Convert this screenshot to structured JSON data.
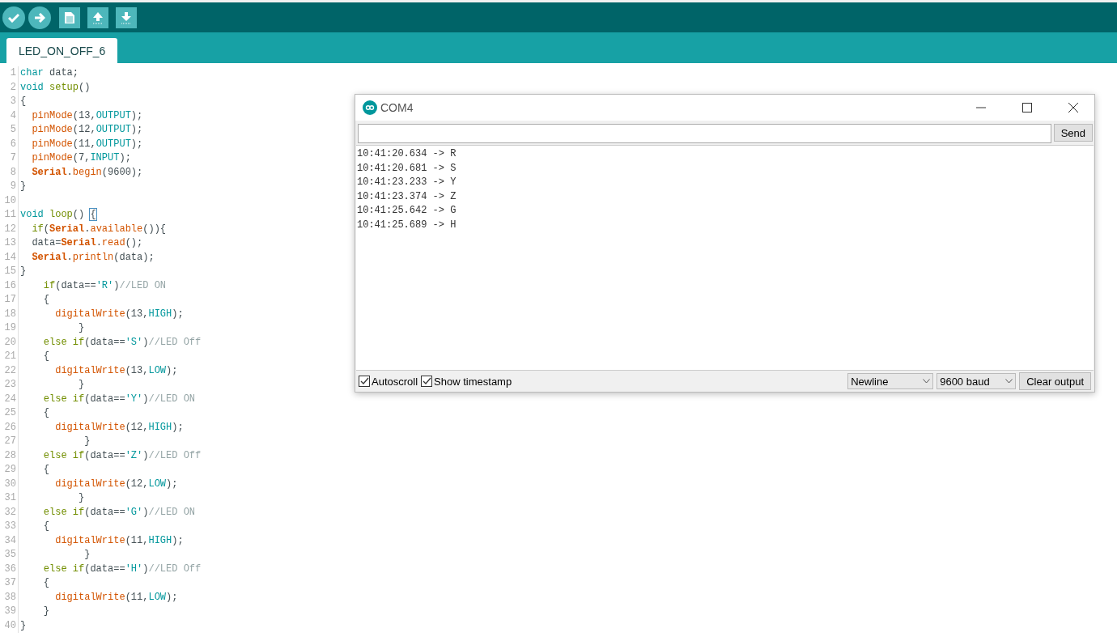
{
  "toolbar": {
    "buttons": [
      {
        "kind": "verify"
      },
      {
        "kind": "upload"
      },
      {
        "kind": "new"
      },
      {
        "kind": "open"
      },
      {
        "kind": "save"
      }
    ]
  },
  "tabs": [
    {
      "label": "LED_ON_OFF_6",
      "selected": true
    }
  ],
  "editor": {
    "lines": [
      {
        "number": "1",
        "tokens": [
          {
            "kind": "type",
            "text": "char"
          },
          {
            "kind": "plain",
            "text": " data;"
          }
        ]
      },
      {
        "number": "2",
        "tokens": [
          {
            "kind": "type",
            "text": "void "
          },
          {
            "kind": "control",
            "text": "setup"
          },
          {
            "kind": "plain",
            "text": "()"
          }
        ]
      },
      {
        "number": "3",
        "tokens": [
          {
            "kind": "plain",
            "text": "{"
          }
        ]
      },
      {
        "number": "4",
        "tokens": [
          {
            "kind": "function",
            "text": "  pinMode"
          },
          {
            "kind": "plain",
            "text": "(13,"
          },
          {
            "kind": "constant",
            "text": "OUTPUT"
          },
          {
            "kind": "plain",
            "text": ");"
          }
        ]
      },
      {
        "number": "5",
        "tokens": [
          {
            "kind": "function",
            "text": "  pinMode"
          },
          {
            "kind": "plain",
            "text": "(12,"
          },
          {
            "kind": "constant",
            "text": "OUTPUT"
          },
          {
            "kind": "plain",
            "text": ");"
          }
        ]
      },
      {
        "number": "6",
        "tokens": [
          {
            "kind": "function",
            "text": "  pinMode"
          },
          {
            "kind": "plain",
            "text": "(11,"
          },
          {
            "kind": "constant",
            "text": "OUTPUT"
          },
          {
            "kind": "plain",
            "text": ");"
          }
        ]
      },
      {
        "number": "7",
        "tokens": [
          {
            "kind": "function",
            "text": "  pinMode"
          },
          {
            "kind": "plain",
            "text": "(7,"
          },
          {
            "kind": "constant",
            "text": "INPUT"
          },
          {
            "kind": "plain",
            "text": ");"
          }
        ]
      },
      {
        "number": "8",
        "tokens": [
          {
            "kind": "object",
            "text": "  Serial"
          },
          {
            "kind": "plain",
            "text": "."
          },
          {
            "kind": "function",
            "text": "begin"
          },
          {
            "kind": "plain",
            "text": "(9600);"
          }
        ]
      },
      {
        "number": "9",
        "tokens": [
          {
            "kind": "plain",
            "text": "}"
          }
        ]
      },
      {
        "number": "10"
      },
      {
        "number": "11",
        "tokens": [
          {
            "kind": "type",
            "text": "void "
          },
          {
            "kind": "control",
            "text": "loop"
          },
          {
            "kind": "plain",
            "text": "() "
          },
          {
            "kind": "bracket_match",
            "text": "{"
          }
        ]
      },
      {
        "number": "12",
        "tokens": [
          {
            "kind": "control",
            "text": "  if"
          },
          {
            "kind": "plain",
            "text": "("
          },
          {
            "kind": "object",
            "text": "Serial"
          },
          {
            "kind": "plain",
            "text": "."
          },
          {
            "kind": "function",
            "text": "available"
          },
          {
            "kind": "plain",
            "text": "()){"
          }
        ]
      },
      {
        "number": "13",
        "tokens": [
          {
            "kind": "plain",
            "text": "  data="
          },
          {
            "kind": "object",
            "text": "Serial"
          },
          {
            "kind": "plain",
            "text": "."
          },
          {
            "kind": "function",
            "text": "read"
          },
          {
            "kind": "plain",
            "text": "();"
          }
        ]
      },
      {
        "number": "14",
        "tokens": [
          {
            "kind": "object",
            "text": "  Serial"
          },
          {
            "kind": "plain",
            "text": "."
          },
          {
            "kind": "function",
            "text": "println"
          },
          {
            "kind": "plain",
            "text": "(data);"
          }
        ]
      },
      {
        "number": "15",
        "tokens": [
          {
            "kind": "plain",
            "text": "}"
          }
        ]
      },
      {
        "number": "16",
        "tokens": [
          {
            "kind": "control",
            "text": "    if"
          },
          {
            "kind": "plain",
            "text": "(data=="
          },
          {
            "kind": "string",
            "text": "'R'"
          },
          {
            "kind": "plain",
            "text": ")"
          },
          {
            "kind": "comment",
            "text": "//LED ON"
          }
        ]
      },
      {
        "number": "17",
        "tokens": [
          {
            "kind": "plain",
            "text": "    {"
          }
        ]
      },
      {
        "number": "18",
        "tokens": [
          {
            "kind": "function",
            "text": "      digitalWrite"
          },
          {
            "kind": "plain",
            "text": "(13,"
          },
          {
            "kind": "constant",
            "text": "HIGH"
          },
          {
            "kind": "plain",
            "text": ");"
          }
        ]
      },
      {
        "number": "19",
        "tokens": [
          {
            "kind": "plain",
            "text": "          }"
          }
        ]
      },
      {
        "number": "20",
        "tokens": [
          {
            "kind": "control",
            "text": "    else if"
          },
          {
            "kind": "plain",
            "text": "(data=="
          },
          {
            "kind": "string",
            "text": "'S'"
          },
          {
            "kind": "plain",
            "text": ")"
          },
          {
            "kind": "comment",
            "text": "//LED Off"
          }
        ]
      },
      {
        "number": "21",
        "tokens": [
          {
            "kind": "plain",
            "text": "    {"
          }
        ]
      },
      {
        "number": "22",
        "tokens": [
          {
            "kind": "function",
            "text": "      digitalWrite"
          },
          {
            "kind": "plain",
            "text": "(13,"
          },
          {
            "kind": "constant",
            "text": "LOW"
          },
          {
            "kind": "plain",
            "text": ");"
          }
        ]
      },
      {
        "number": "23",
        "tokens": [
          {
            "kind": "plain",
            "text": "          }"
          }
        ]
      },
      {
        "number": "24",
        "tokens": [
          {
            "kind": "control",
            "text": "    else if"
          },
          {
            "kind": "plain",
            "text": "(data=="
          },
          {
            "kind": "string",
            "text": "'Y'"
          },
          {
            "kind": "plain",
            "text": ")"
          },
          {
            "kind": "comment",
            "text": "//LED ON"
          }
        ]
      },
      {
        "number": "25",
        "tokens": [
          {
            "kind": "plain",
            "text": "    {"
          }
        ]
      },
      {
        "number": "26",
        "tokens": [
          {
            "kind": "function",
            "text": "      digitalWrite"
          },
          {
            "kind": "plain",
            "text": "(12,"
          },
          {
            "kind": "constant",
            "text": "HIGH"
          },
          {
            "kind": "plain",
            "text": ");"
          }
        ]
      },
      {
        "number": "27",
        "tokens": [
          {
            "kind": "plain",
            "text": "           }"
          }
        ]
      },
      {
        "number": "28",
        "tokens": [
          {
            "kind": "control",
            "text": "    else if"
          },
          {
            "kind": "plain",
            "text": "(data=="
          },
          {
            "kind": "string",
            "text": "'Z'"
          },
          {
            "kind": "plain",
            "text": ")"
          },
          {
            "kind": "comment",
            "text": "//LED Off"
          }
        ]
      },
      {
        "number": "29",
        "tokens": [
          {
            "kind": "plain",
            "text": "    {"
          }
        ]
      },
      {
        "number": "30",
        "tokens": [
          {
            "kind": "function",
            "text": "      digitalWrite"
          },
          {
            "kind": "plain",
            "text": "(12,"
          },
          {
            "kind": "constant",
            "text": "LOW"
          },
          {
            "kind": "plain",
            "text": ");"
          }
        ]
      },
      {
        "number": "31",
        "tokens": [
          {
            "kind": "plain",
            "text": "          }"
          }
        ]
      },
      {
        "number": "32",
        "tokens": [
          {
            "kind": "control",
            "text": "    else if"
          },
          {
            "kind": "plain",
            "text": "(data=="
          },
          {
            "kind": "string",
            "text": "'G'"
          },
          {
            "kind": "plain",
            "text": ")"
          },
          {
            "kind": "comment",
            "text": "//LED ON"
          }
        ]
      },
      {
        "number": "33",
        "tokens": [
          {
            "kind": "plain",
            "text": "    {"
          }
        ]
      },
      {
        "number": "34",
        "tokens": [
          {
            "kind": "function",
            "text": "      digitalWrite"
          },
          {
            "kind": "plain",
            "text": "(11,"
          },
          {
            "kind": "constant",
            "text": "HIGH"
          },
          {
            "kind": "plain",
            "text": ");"
          }
        ]
      },
      {
        "number": "35",
        "tokens": [
          {
            "kind": "plain",
            "text": "           }"
          }
        ]
      },
      {
        "number": "36",
        "tokens": [
          {
            "kind": "control",
            "text": "    else if"
          },
          {
            "kind": "plain",
            "text": "(data=="
          },
          {
            "kind": "string",
            "text": "'H'"
          },
          {
            "kind": "plain",
            "text": ")"
          },
          {
            "kind": "comment",
            "text": "//LED Off"
          }
        ]
      },
      {
        "number": "37",
        "tokens": [
          {
            "kind": "plain",
            "text": "    {"
          }
        ]
      },
      {
        "number": "38",
        "tokens": [
          {
            "kind": "function",
            "text": "      digitalWrite"
          },
          {
            "kind": "plain",
            "text": "(11,"
          },
          {
            "kind": "constant",
            "text": "LOW"
          },
          {
            "kind": "plain",
            "text": ");"
          }
        ]
      },
      {
        "number": "39",
        "tokens": [
          {
            "kind": "plain",
            "text": "    }"
          }
        ]
      },
      {
        "number": "40",
        "tokens": [
          {
            "kind": "plain",
            "text": "}"
          }
        ]
      }
    ]
  },
  "serial_monitor": {
    "window": {
      "title": "COM4"
    },
    "send_button": "Send",
    "output": [
      "10:41:20.634 -> R",
      "10:41:20.681 -> S",
      "10:41:23.233 -> Y",
      "10:41:23.374 -> Z",
      "10:41:25.642 -> G",
      "10:41:25.689 -> H"
    ],
    "options": [
      {
        "label": "Autoscroll",
        "checked": true
      },
      {
        "label": "Show timestamp",
        "checked": true
      }
    ],
    "line_ending": "Newline",
    "baud_rate": "9600 baud",
    "clear_button": "Clear output"
  }
}
